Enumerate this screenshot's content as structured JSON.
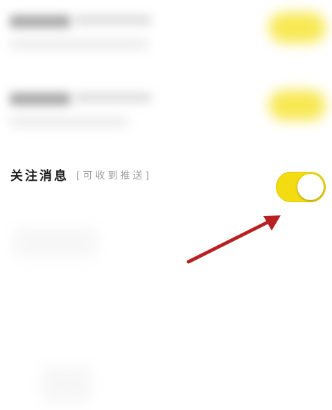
{
  "setting": {
    "title": "关注消息",
    "hint": "[可收到推送]",
    "toggle_on": true
  },
  "colors": {
    "toggle_on": "#f3dc12",
    "knob": "#ffffff",
    "title": "#1c1c1c",
    "hint": "#9a9a9a",
    "arrow": "#b82121"
  },
  "icons": {
    "annotation": "arrow-icon"
  }
}
